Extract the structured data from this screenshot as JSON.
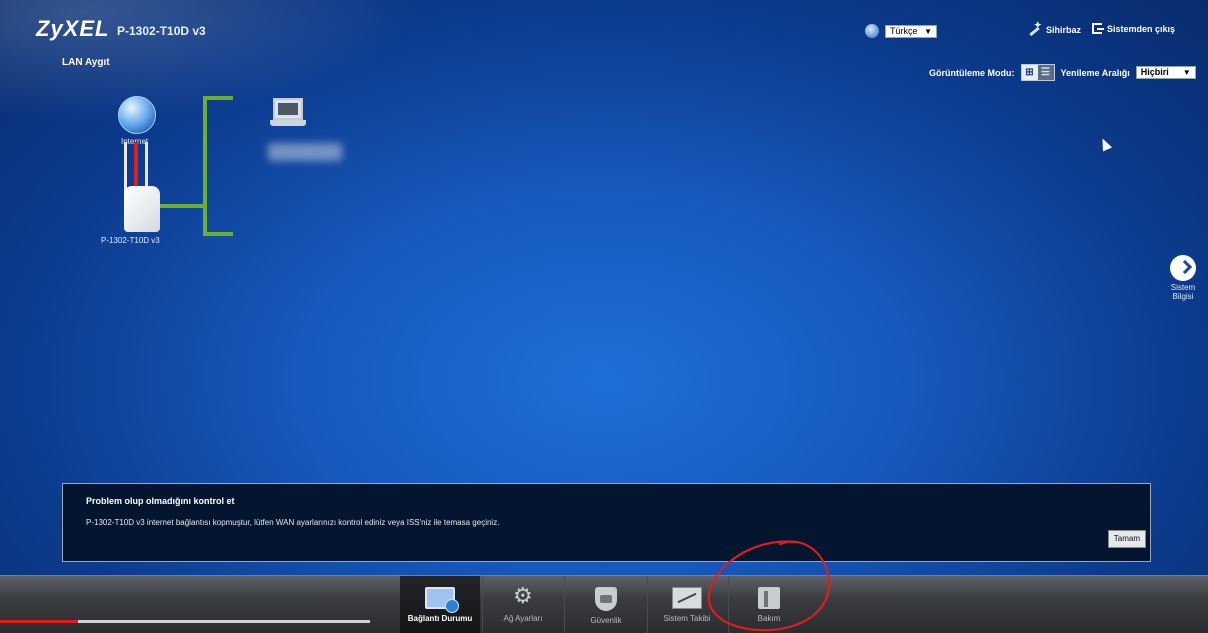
{
  "header": {
    "brand": "ZyXEL",
    "model": "P-1302-T10D v3",
    "page_title": "LAN Aygıt",
    "language_select": {
      "value": "Türkçe",
      "icon": "globe-icon"
    },
    "wizard_label": "Sihirbaz",
    "logout_label": "Sistemden çıkış"
  },
  "toolbar": {
    "view_mode_label": "Görüntüleme Modu:",
    "refresh_label": "Yenileme Aralığı",
    "refresh_select_value": "Hiçbiri"
  },
  "topology": {
    "internet_label": "Internet",
    "router_label": "P-1302-T10D v3",
    "link_color": "#6cae2e"
  },
  "side_panel": {
    "system_info_label": "Sistem Bilgisi"
  },
  "alert": {
    "title": "Problem olup olmadığını kontrol et",
    "message": "P-1302-T10D v3 internet bağlantısı kopmuştur, lütfen WAN ayarlarınızı kontrol ediniz veya ISS'niz ile temasa geçiniz.",
    "ok_button": "Tamam"
  },
  "bottom_nav": {
    "items": [
      {
        "label": "Bağlantı Durumu",
        "icon": "monitor-icon",
        "active": true
      },
      {
        "label": "Ağ Ayarları",
        "icon": "cog-icon",
        "active": false
      },
      {
        "label": "Güvenlik",
        "icon": "shield-icon",
        "active": false
      },
      {
        "label": "Sistem Takibi",
        "icon": "chart-icon",
        "active": false
      },
      {
        "label": "Bakım",
        "icon": "tools-icon",
        "active": false
      }
    ]
  },
  "video_progress": {
    "fraction": 0.21,
    "color": "#e01c1c"
  },
  "colors": {
    "background": "#1659bd",
    "alert_background": "#04162f",
    "annotation": "#e01c1c"
  }
}
